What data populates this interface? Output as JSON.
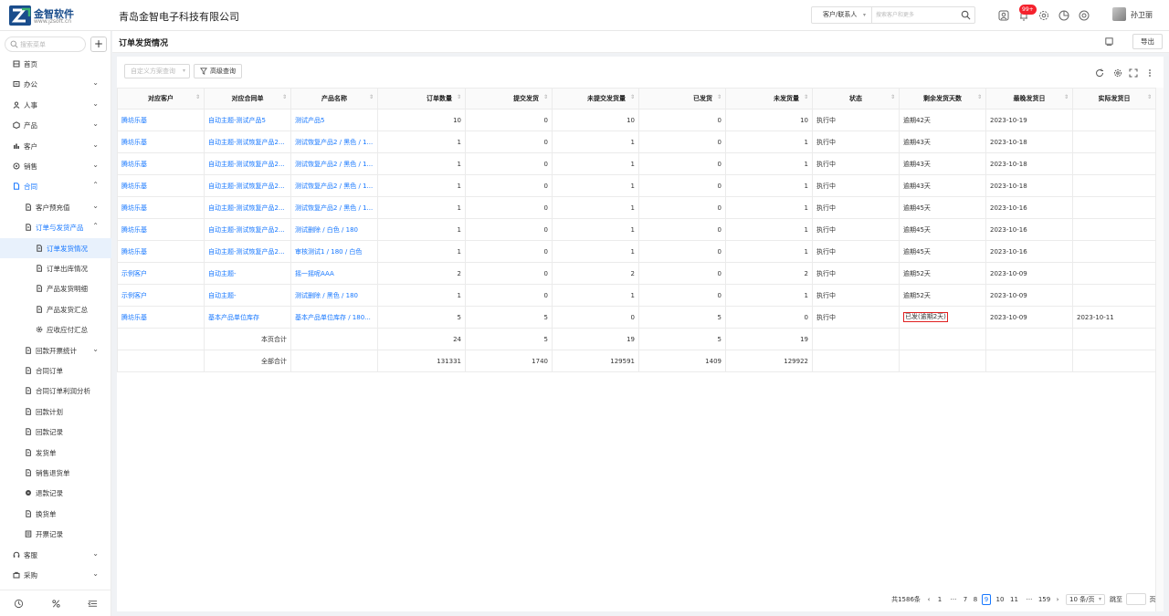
{
  "header": {
    "logo_name": "金智软件",
    "logo_url": "www.jzsoft.cn",
    "company": "青岛金智电子科技有限公司",
    "search_type": "客户/联系人",
    "search_placeholder": "搜索客户和更多",
    "badge": "99+",
    "user": "孙卫丽",
    "icons": [
      "contacts-icon",
      "bell-icon",
      "settings-icon",
      "chart-icon",
      "help-icon"
    ]
  },
  "sidebar": {
    "search_placeholder": "搜索菜单",
    "add": "+",
    "items": [
      {
        "label": "首页",
        "icon": "home-icon",
        "level": 0
      },
      {
        "label": "办公",
        "icon": "office-icon",
        "level": 0,
        "caret": true
      },
      {
        "label": "人事",
        "icon": "person-icon",
        "level": 0,
        "caret": true
      },
      {
        "label": "产品",
        "icon": "box-icon",
        "level": 0,
        "caret": true
      },
      {
        "label": "客户",
        "icon": "customer-icon",
        "level": 0,
        "caret": true
      },
      {
        "label": "销售",
        "icon": "sales-icon",
        "level": 0,
        "caret": true
      },
      {
        "label": "合同",
        "icon": "contract-icon",
        "level": 0,
        "caret": true,
        "open": true
      },
      {
        "label": "客户预充值",
        "icon": "doc-icon",
        "level": 1,
        "caret": true
      },
      {
        "label": "订单与发货产品",
        "icon": "doc-icon",
        "level": 1,
        "caret": true,
        "open": true
      },
      {
        "label": "订单发货情况",
        "icon": "doc-icon",
        "level": 2,
        "active": true
      },
      {
        "label": "订单出库情况",
        "icon": "doc-icon",
        "level": 2
      },
      {
        "label": "产品发货明细",
        "icon": "doc-icon",
        "level": 2
      },
      {
        "label": "产品发货汇总",
        "icon": "doc-icon",
        "level": 2
      },
      {
        "label": "应收应付汇总",
        "icon": "gear-icon",
        "level": 2
      },
      {
        "label": "回款开票统计",
        "icon": "doc-icon",
        "level": 1,
        "caret": true
      },
      {
        "label": "合同订单",
        "icon": "doc-icon",
        "level": 1
      },
      {
        "label": "合同订单利润分析",
        "icon": "doc-icon",
        "level": 1
      },
      {
        "label": "回款计划",
        "icon": "doc-icon",
        "level": 1
      },
      {
        "label": "回款记录",
        "icon": "doc-icon",
        "level": 1
      },
      {
        "label": "发货单",
        "icon": "doc-icon",
        "level": 1
      },
      {
        "label": "销售退货单",
        "icon": "doc-icon",
        "level": 1
      },
      {
        "label": "退款记录",
        "icon": "refund-icon",
        "level": 1
      },
      {
        "label": "换货单",
        "icon": "doc-icon",
        "level": 1
      },
      {
        "label": "开票记录",
        "icon": "invoice-icon",
        "level": 1
      },
      {
        "label": "客服",
        "icon": "service-icon",
        "level": 0,
        "caret": true
      },
      {
        "label": "采购",
        "icon": "purchase-icon",
        "level": 0,
        "caret": true
      }
    ]
  },
  "page": {
    "title": "订单发货情况",
    "export": "导出",
    "scheme_placeholder": "自定义方案查询",
    "advanced": "高级查询"
  },
  "table": {
    "columns": [
      "对应客户",
      "对应合同单",
      "产品名称",
      "订单数量",
      "提交发货",
      "未提交发货量",
      "已发货",
      "未发货量",
      "状态",
      "剩余发货天数",
      "最晚发货日",
      "实际发货日"
    ],
    "rows": [
      [
        "腾坊乐基",
        "自动主题-测试产品5",
        "测试产品5",
        "10",
        "0",
        "10",
        "0",
        "10",
        "执行中",
        "逾期42天",
        "2023-10-19",
        ""
      ],
      [
        "腾坊乐基",
        "自动主题-测试恢复产品2...",
        "测试恢复产品2 / 黑色 / 1...",
        "1",
        "0",
        "1",
        "0",
        "1",
        "执行中",
        "逾期43天",
        "2023-10-18",
        ""
      ],
      [
        "腾坊乐基",
        "自动主题-测试恢复产品2...",
        "测试恢复产品2 / 黑色 / 1...",
        "1",
        "0",
        "1",
        "0",
        "1",
        "执行中",
        "逾期43天",
        "2023-10-18",
        ""
      ],
      [
        "腾坊乐基",
        "自动主题-测试恢复产品2...",
        "测试恢复产品2 / 黑色 / 1...",
        "1",
        "0",
        "1",
        "0",
        "1",
        "执行中",
        "逾期43天",
        "2023-10-18",
        ""
      ],
      [
        "腾坊乐基",
        "自动主题-测试恢复产品2...",
        "测试恢复产品2 / 黑色 / 1...",
        "1",
        "0",
        "1",
        "0",
        "1",
        "执行中",
        "逾期45天",
        "2023-10-16",
        ""
      ],
      [
        "腾坊乐基",
        "自动主题-测试恢复产品2...",
        "测试删除 / 白色 / 180",
        "1",
        "0",
        "1",
        "0",
        "1",
        "执行中",
        "逾期45天",
        "2023-10-16",
        ""
      ],
      [
        "腾坊乐基",
        "自动主题-测试恢复产品2...",
        "审核测试1 / 180 / 白色",
        "1",
        "0",
        "1",
        "0",
        "1",
        "执行中",
        "逾期45天",
        "2023-10-16",
        ""
      ],
      [
        "示例客户",
        "自动主题-",
        "摇一摇呢AAA",
        "2",
        "0",
        "2",
        "0",
        "2",
        "执行中",
        "逾期52天",
        "2023-10-09",
        ""
      ],
      [
        "示例客户",
        "自动主题-",
        "测试删除 / 黑色 / 180",
        "1",
        "0",
        "1",
        "0",
        "1",
        "执行中",
        "逾期52天",
        "2023-10-09",
        ""
      ],
      [
        "腾坊乐基",
        "基本产品单位库存",
        "基本产品单位库存 / 180...",
        "5",
        "5",
        "0",
        "5",
        "0",
        "执行中",
        "已发(逾期2天)",
        "2023-10-09",
        "2023-10-11"
      ]
    ],
    "page_total_label": "本页合计",
    "page_total": [
      "24",
      "5",
      "19",
      "5",
      "19"
    ],
    "all_total_label": "全部合计",
    "all_total": [
      "131331",
      "1740",
      "129591",
      "1409",
      "129922"
    ]
  },
  "pagination": {
    "total": "共1586条",
    "prev": "‹",
    "pages": [
      "1",
      "···",
      "7",
      "8",
      "9",
      "10",
      "11",
      "···",
      "159"
    ],
    "current": "9",
    "next": "›",
    "size": "10 条/页",
    "jump_label": "跳至",
    "page_unit": "页"
  },
  "colors": {
    "accent": "#1677ff",
    "overdue_box": "#e02020",
    "badge": "#f5222d"
  }
}
